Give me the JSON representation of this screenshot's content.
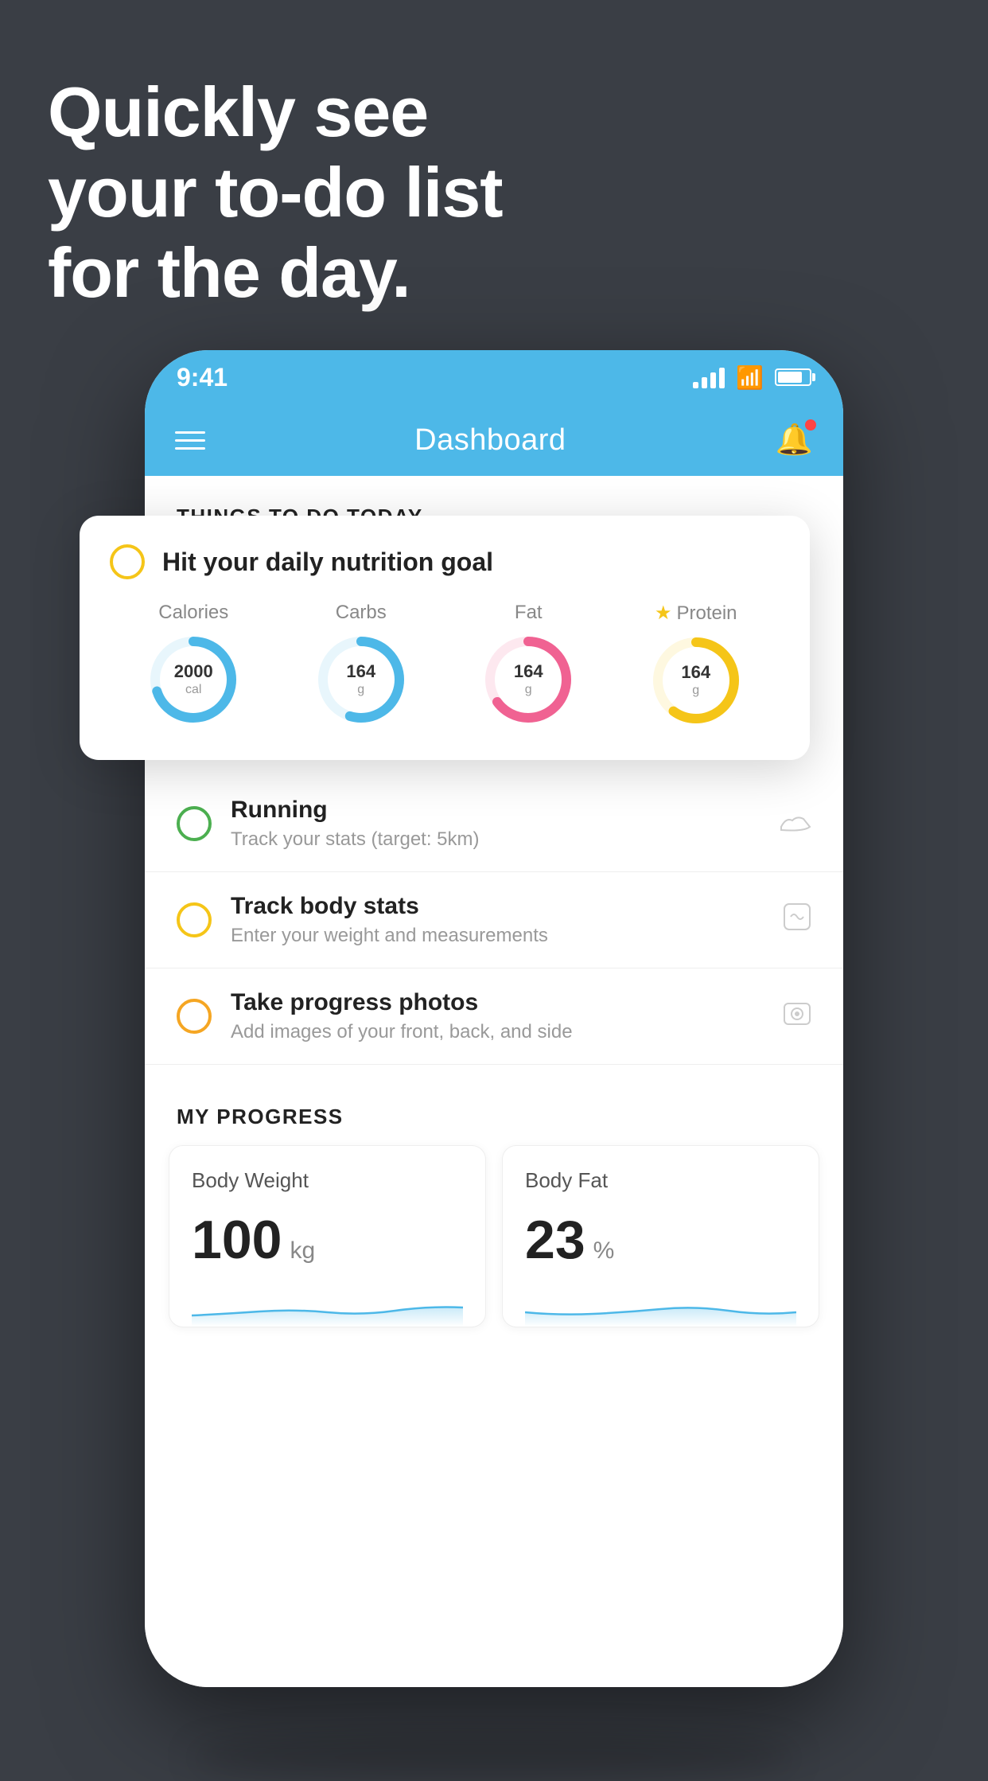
{
  "background": {
    "color": "#3a3e45"
  },
  "headline": {
    "line1": "Quickly see",
    "line2": "your to-do list",
    "line3": "for the day."
  },
  "status_bar": {
    "time": "9:41",
    "wifi": "wifi",
    "battery": "battery"
  },
  "header": {
    "title": "Dashboard",
    "hamburger_icon": "hamburger",
    "bell_icon": "bell"
  },
  "things_to_do": {
    "section_label": "THINGS TO DO TODAY",
    "items": [
      {
        "id": "nutrition",
        "title": "Hit your daily nutrition goal",
        "radio_color": "yellow",
        "icon": "nutrition-icon",
        "highlighted": true
      },
      {
        "id": "running",
        "title": "Running",
        "subtitle": "Track your stats (target: 5km)",
        "radio_color": "green",
        "icon": "shoe-icon"
      },
      {
        "id": "body-stats",
        "title": "Track body stats",
        "subtitle": "Enter your weight and measurements",
        "radio_color": "yellow",
        "icon": "scale-icon"
      },
      {
        "id": "photos",
        "title": "Take progress photos",
        "subtitle": "Add images of your front, back, and side",
        "radio_color": "yellow",
        "icon": "photo-icon"
      }
    ]
  },
  "nutrition_card": {
    "title": "Hit your daily nutrition goal",
    "metrics": [
      {
        "label": "Calories",
        "value": "2000",
        "unit": "cal",
        "color": "#4db8e8",
        "track_color": "#e8f6fc",
        "percent": 70
      },
      {
        "label": "Carbs",
        "value": "164",
        "unit": "g",
        "color": "#4db8e8",
        "track_color": "#e8f6fc",
        "percent": 55
      },
      {
        "label": "Fat",
        "value": "164",
        "unit": "g",
        "color": "#f06292",
        "track_color": "#fde8ef",
        "percent": 65
      },
      {
        "label": "Protein",
        "value": "164",
        "unit": "g",
        "color": "#f5c518",
        "track_color": "#fef8e0",
        "percent": 60,
        "starred": true
      }
    ]
  },
  "progress": {
    "section_label": "MY PROGRESS",
    "cards": [
      {
        "title": "Body Weight",
        "value": "100",
        "unit": "kg"
      },
      {
        "title": "Body Fat",
        "value": "23",
        "unit": "%"
      }
    ]
  }
}
